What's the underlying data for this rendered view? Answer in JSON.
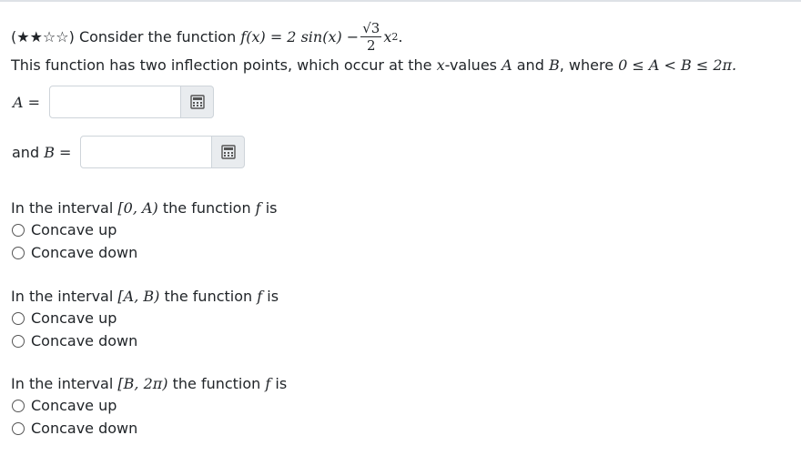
{
  "question": {
    "stars": "(★★☆☆)",
    "intro": "Consider the function",
    "func_lhs": "f(x) = 2 sin(x) −",
    "frac_num": "√3",
    "frac_den": "2",
    "func_tail": "x",
    "func_exp": "2",
    "period": ".",
    "line2_pre": "This function has two inflection points, which occur at the",
    "line2_var": "x",
    "line2_mid": "-values",
    "line2_A": "A",
    "line2_and": "and",
    "line2_B": "B",
    "line2_where": ", where",
    "line2_cond": "0 ≤ A < B ≤ 2π."
  },
  "answers": {
    "A_label": "A =",
    "B_prefix": "and",
    "B_label": "B ="
  },
  "sections": [
    {
      "prompt_pre": "In the interval",
      "interval": "[0, A)",
      "prompt_post": "the function",
      "fvar": "f",
      "prompt_end": "is",
      "options": [
        "Concave up",
        "Concave down"
      ]
    },
    {
      "prompt_pre": "In the interval",
      "interval": "[A, B)",
      "prompt_post": "the function",
      "fvar": "f",
      "prompt_end": "is",
      "options": [
        "Concave up",
        "Concave down"
      ]
    },
    {
      "prompt_pre": "In the interval",
      "interval": "[B, 2π)",
      "prompt_post": "the function",
      "fvar": "f",
      "prompt_end": "is",
      "options": [
        "Concave up",
        "Concave down"
      ]
    }
  ],
  "icons": {
    "answer_button": "calculator-grid-icon"
  },
  "colors": {
    "border": "#ced4da",
    "button_bg": "#e9ecef",
    "text": "#212529"
  }
}
